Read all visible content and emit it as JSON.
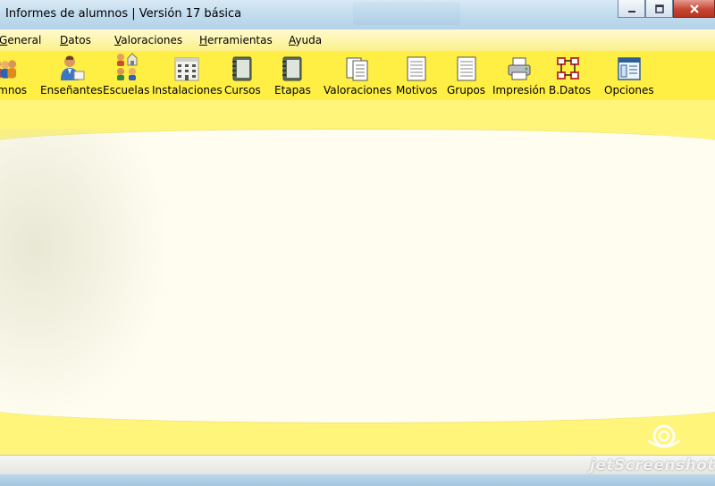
{
  "window": {
    "title": "Informes de alumnos | Versión 17 básica",
    "controls": [
      "minimize-icon",
      "maximize-icon",
      "close-icon"
    ]
  },
  "menu": [
    {
      "pre": "",
      "acc": "G",
      "post": "eneral"
    },
    {
      "pre": "",
      "acc": "D",
      "post": "atos"
    },
    {
      "pre": "",
      "acc": "V",
      "post": "aloraciones"
    },
    {
      "pre": "",
      "acc": "H",
      "post": "erramientas"
    },
    {
      "pre": "",
      "acc": "A",
      "post": "yuda"
    }
  ],
  "toolbar": [
    {
      "label": "Alumnos",
      "icon": "students-icon"
    },
    {
      "label": "Enseñantes",
      "icon": "teacher-icon"
    },
    {
      "label": "Escuelas",
      "icon": "schools-icon"
    },
    {
      "label": "Instalaciones",
      "icon": "building-icon"
    },
    {
      "label": "Cursos",
      "icon": "notebook-icon"
    },
    {
      "label": "Etapas",
      "icon": "notebook-icon"
    },
    {
      "label": "Valoraciones",
      "icon": "pages-icon"
    },
    {
      "label": "Motivos",
      "icon": "page-icon"
    },
    {
      "label": "Grupos",
      "icon": "page-icon"
    },
    {
      "label": "Impresión",
      "icon": "printer-icon"
    },
    {
      "label": "B.Datos",
      "icon": "database-tree-icon"
    },
    {
      "label": "Opciones",
      "icon": "options-window-icon"
    }
  ],
  "watermark": "jetScreenshot",
  "colors": {
    "toolbar": "#ffee44",
    "menubar": "#fbf08a",
    "panel": "#fefdf0",
    "titlebar": "#c2dcee"
  }
}
